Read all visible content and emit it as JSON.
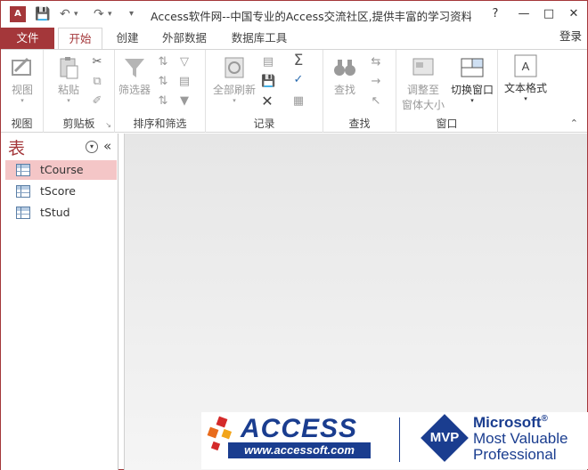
{
  "titlebar": {
    "app_icon_label": "A",
    "title": "Access软件网--中国专业的Access交流社区,提供丰富的学习资料...",
    "help": "?",
    "minimize": "—",
    "restore": "□",
    "close": "✕"
  },
  "tabs": {
    "file": "文件",
    "items": [
      "开始",
      "创建",
      "外部数据",
      "数据库工具"
    ],
    "active": "开始",
    "login": "登录"
  },
  "ribbon": {
    "groups": {
      "views": {
        "label": "视图",
        "btn": "视图"
      },
      "clipboard": {
        "label": "剪贴板",
        "paste": "粘贴"
      },
      "sort_filter": {
        "label": "排序和筛选",
        "filter": "筛选器"
      },
      "records": {
        "label": "记录",
        "refresh": "全部刷新"
      },
      "find": {
        "label": "查找",
        "find": "查找"
      },
      "window": {
        "label": "窗口",
        "fit_line1": "调整至",
        "fit_line2": "窗体大小",
        "switch": "切换窗口"
      },
      "text": {
        "format": "文本格式"
      }
    }
  },
  "nav": {
    "title": "表",
    "items": [
      {
        "label": "tCourse",
        "selected": true
      },
      {
        "label": "tScore",
        "selected": false
      },
      {
        "label": "tStud",
        "selected": false
      }
    ]
  },
  "banner": {
    "access_title": "ACCESS",
    "access_url": "www.accessoft.com",
    "mvp": "MVP",
    "ms_line1": "Microsoft",
    "ms_reg": "®",
    "ms_line2": "Most Valuable",
    "ms_line3": "Professional"
  },
  "colors": {
    "accent": "#a4373a",
    "selection": "#f4c6c7",
    "banner_blue": "#1a3d8f"
  }
}
